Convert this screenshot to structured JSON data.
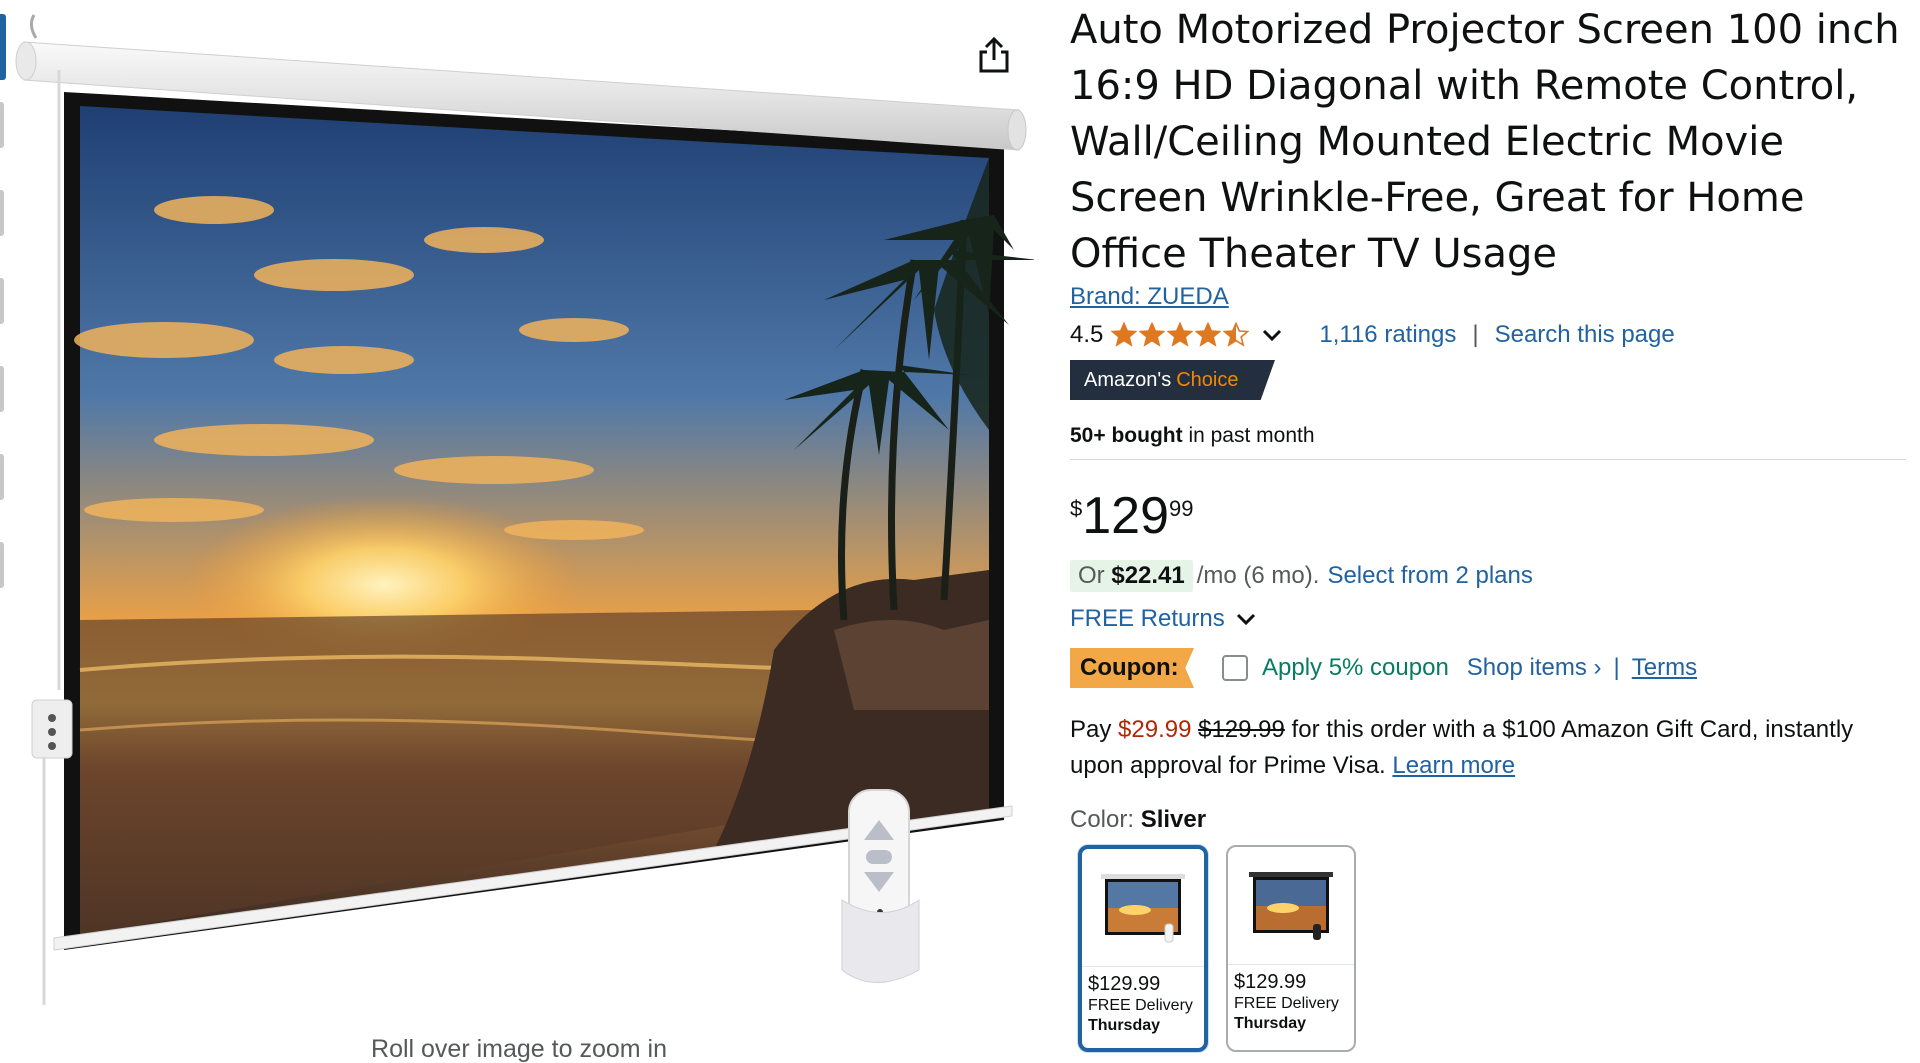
{
  "thumbnails": {
    "count": 7,
    "active_index": 0
  },
  "image": {
    "zoom_hint": "Roll over image to zoom in"
  },
  "product": {
    "title": "Auto Motorized Projector Screen 100 inch 16:9 HD Diagonal with Remote Control, Wall/Ceiling Mounted Electric Movie Screen Wrinkle-Free, Great for Home Office Theater TV Usage",
    "brand": "Brand: ZUEDA",
    "rating": "4.5",
    "rating_stars": 4.5,
    "ratings_count": "1,116 ratings",
    "separator": "|",
    "search_page": "Search this page",
    "badge": {
      "prefix": "Amazon's",
      "choice": "Choice"
    },
    "bought_bold": "50+ bought",
    "bought_rest": "in past month"
  },
  "price": {
    "symbol": "$",
    "whole": "129",
    "fraction": "99",
    "monthly_or": "Or",
    "monthly_amount": "$22.41",
    "monthly_rest": "/mo (6 mo).",
    "plans_link": "Select from 2 plans",
    "returns": "FREE Returns"
  },
  "coupon": {
    "badge": "Coupon:",
    "checked": false,
    "apply": "Apply 5% coupon",
    "shop": "Shop items ›",
    "separator": "|",
    "terms": "Terms"
  },
  "giftcard": {
    "pay": "Pay",
    "new_price": "$29.99",
    "old_price": "$129.99",
    "text": "for this order with a $100 Amazon Gift Card, instantly upon approval for Prime Visa.",
    "learn_more": "Learn more"
  },
  "color": {
    "label": "Color:",
    "value": "Sliver",
    "options": [
      {
        "price": "$129.99",
        "delivery": "FREE Delivery",
        "day": "Thursday",
        "selected": true
      },
      {
        "price": "$129.99",
        "delivery": "FREE Delivery",
        "day": "Thursday",
        "selected": false
      }
    ]
  },
  "colors": {
    "link": "#2162a1",
    "price_red": "#b12704",
    "coupon_orange": "#f3a847",
    "coupon_green": "#067d62",
    "star": "#de7921",
    "badge_dark": "#232f3e"
  }
}
